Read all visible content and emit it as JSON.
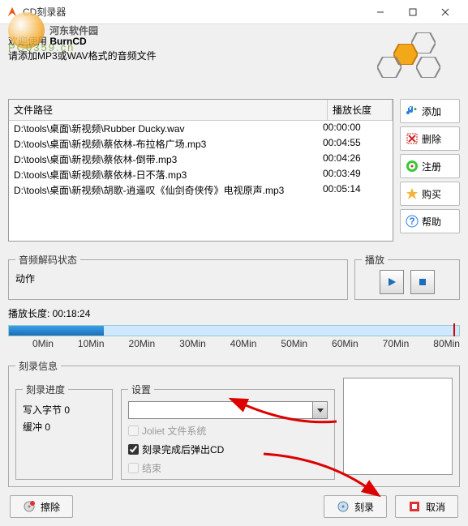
{
  "window": {
    "title": "CD刻录器",
    "watermark_main": "河东软件园",
    "watermark_sub": "PC0359.cn"
  },
  "intro": {
    "line1_prefix": "欢迎使用 ",
    "line1_bold": "BurnCD",
    "line2": "请添加MP3或WAV格式的音频文件"
  },
  "filelist": {
    "col_path": "文件路径",
    "col_duration": "播放长度",
    "rows": [
      {
        "path": "D:\\tools\\桌面\\新视频\\Rubber Ducky.wav",
        "dur": "00:00:00"
      },
      {
        "path": "D:\\tools\\桌面\\新视频\\蔡依林-布拉格广场.mp3",
        "dur": "00:04:55"
      },
      {
        "path": "D:\\tools\\桌面\\新视频\\蔡依林-倒带.mp3",
        "dur": "00:04:26"
      },
      {
        "path": "D:\\tools\\桌面\\新视频\\蔡依林-日不落.mp3",
        "dur": "00:03:49"
      },
      {
        "path": "D:\\tools\\桌面\\新视频\\胡歌-逍遥叹《仙剑奇侠传》电视原声.mp3",
        "dur": "00:05:14"
      }
    ]
  },
  "sidebar": {
    "add": "添加",
    "delete": "删除",
    "register": "注册",
    "buy": "购买",
    "help": "帮助"
  },
  "status": {
    "decode_legend": "音频解码状态",
    "action_label": "动作",
    "play_legend": "播放"
  },
  "length": {
    "label_prefix": "播放长度: ",
    "value": "00:18:24",
    "ticks": [
      "0Min",
      "10Min",
      "20Min",
      "30Min",
      "40Min",
      "50Min",
      "60Min",
      "70Min",
      "80Min"
    ]
  },
  "burn": {
    "legend": "刻录信息",
    "progress_legend": "刻录进度",
    "bytes_label": "写入字节",
    "bytes_value": "0",
    "buffer_label": "缓冲",
    "buffer_value": "0",
    "settings_legend": "设置",
    "chk_joliet": "Joliet 文件系统",
    "chk_eject": "刻录完成后弹出CD",
    "chk_end": "结束"
  },
  "footer": {
    "erase": "擦除",
    "burn": "刻录",
    "cancel": "取消"
  }
}
